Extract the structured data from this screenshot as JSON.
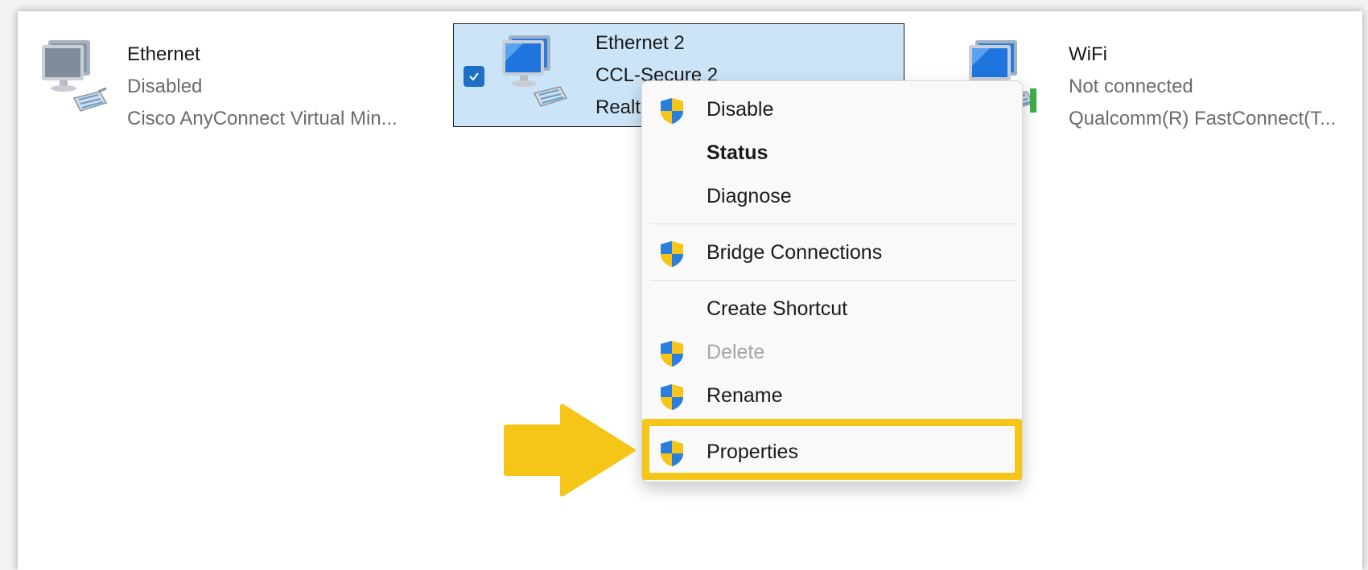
{
  "adapters": [
    {
      "name": "Ethernet",
      "status": "Disabled",
      "device": "Cisco AnyConnect Virtual Min..."
    },
    {
      "name": "Ethernet 2",
      "status": "CCL-Secure 2",
      "device": "Realtek"
    },
    {
      "name": "WiFi",
      "status": "Not connected",
      "device": "Qualcomm(R) FastConnect(T..."
    }
  ],
  "context_menu": {
    "items": [
      {
        "label": "Disable",
        "icon": "uac-shield-icon"
      },
      {
        "label": "Status"
      },
      {
        "label": "Diagnose"
      },
      {
        "label": "Bridge Connections",
        "icon": "uac-shield-icon"
      },
      {
        "label": "Create Shortcut"
      },
      {
        "label": "Delete",
        "icon": "uac-shield-icon",
        "disabled": true
      },
      {
        "label": "Rename",
        "icon": "uac-shield-icon"
      },
      {
        "label": "Properties",
        "icon": "uac-shield-icon",
        "highlighted": true
      }
    ]
  },
  "colors": {
    "selection": "#cce4f7",
    "highlight": "#f5c518",
    "checkbox": "#1f6fc5"
  }
}
